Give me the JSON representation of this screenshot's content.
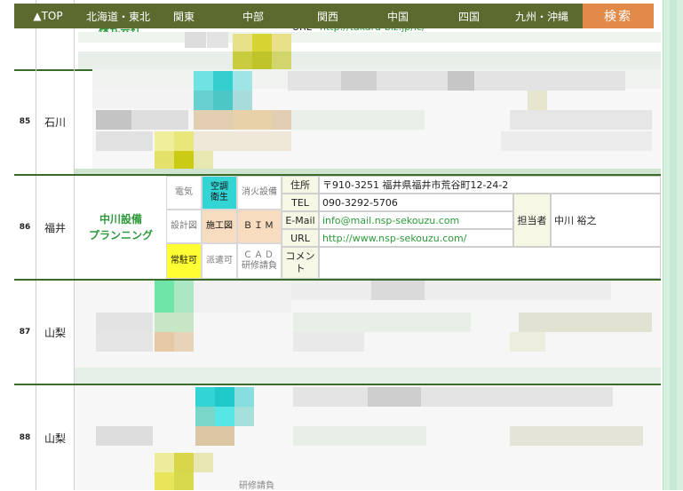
{
  "nav": {
    "items": [
      "▲TOP",
      "北海道・東北",
      "関東",
      "中部",
      "関西",
      "中国",
      "四国",
      "九州・沖縄"
    ],
    "search_label": "検索"
  },
  "top_partial": {
    "company_text": "株式会社",
    "url_label": "URL",
    "url_value": "http://takara-biz.jp/ic/"
  },
  "rows": [
    {
      "num": "85",
      "pref": "石川"
    },
    {
      "num": "86",
      "pref": "福井"
    },
    {
      "num": "87",
      "pref": "山梨"
    },
    {
      "num": "88",
      "pref": "山梨"
    }
  ],
  "fukui": {
    "company_line1": "中川設備",
    "company_line2": "プランニング",
    "tags": {
      "denki": "電気",
      "kucho_1": "空調",
      "kucho_2": "衛生",
      "shoka": "消火設備",
      "sekkei": "設計図",
      "seko": "施工図",
      "bim": "ＢＩＭ",
      "jochu": "常駐可",
      "haken": "派遣可",
      "cad_1": "ＣＡＤ",
      "cad_2": "研修請負"
    },
    "labels": {
      "address": "住所",
      "tel": "TEL",
      "email": "E-Mail",
      "url": "URL",
      "comment_1": "コメン",
      "comment_2": "ト",
      "contact": "担当者"
    },
    "values": {
      "address": "〒910-3251 福井県福井市荒谷町12-24-2",
      "tel": "090-3292-5706",
      "email": "info@mail.nsp-sekouzu.com",
      "url": "http://www.nsp-sekouzu.com/",
      "contact": "中川 裕之"
    }
  },
  "bottom_partial": {
    "text": "研修請負"
  },
  "colors": {
    "nav_bg": "#5b6b30",
    "search_bg": "#e28a4a",
    "row_border": "#3b6b2a",
    "link": "#2c9a3a",
    "kucho_bg": "#33d4d4",
    "seko_bg": "#f7dcbf",
    "jochu_bg": "#ffff33",
    "right_strip": "#d6f0df"
  }
}
